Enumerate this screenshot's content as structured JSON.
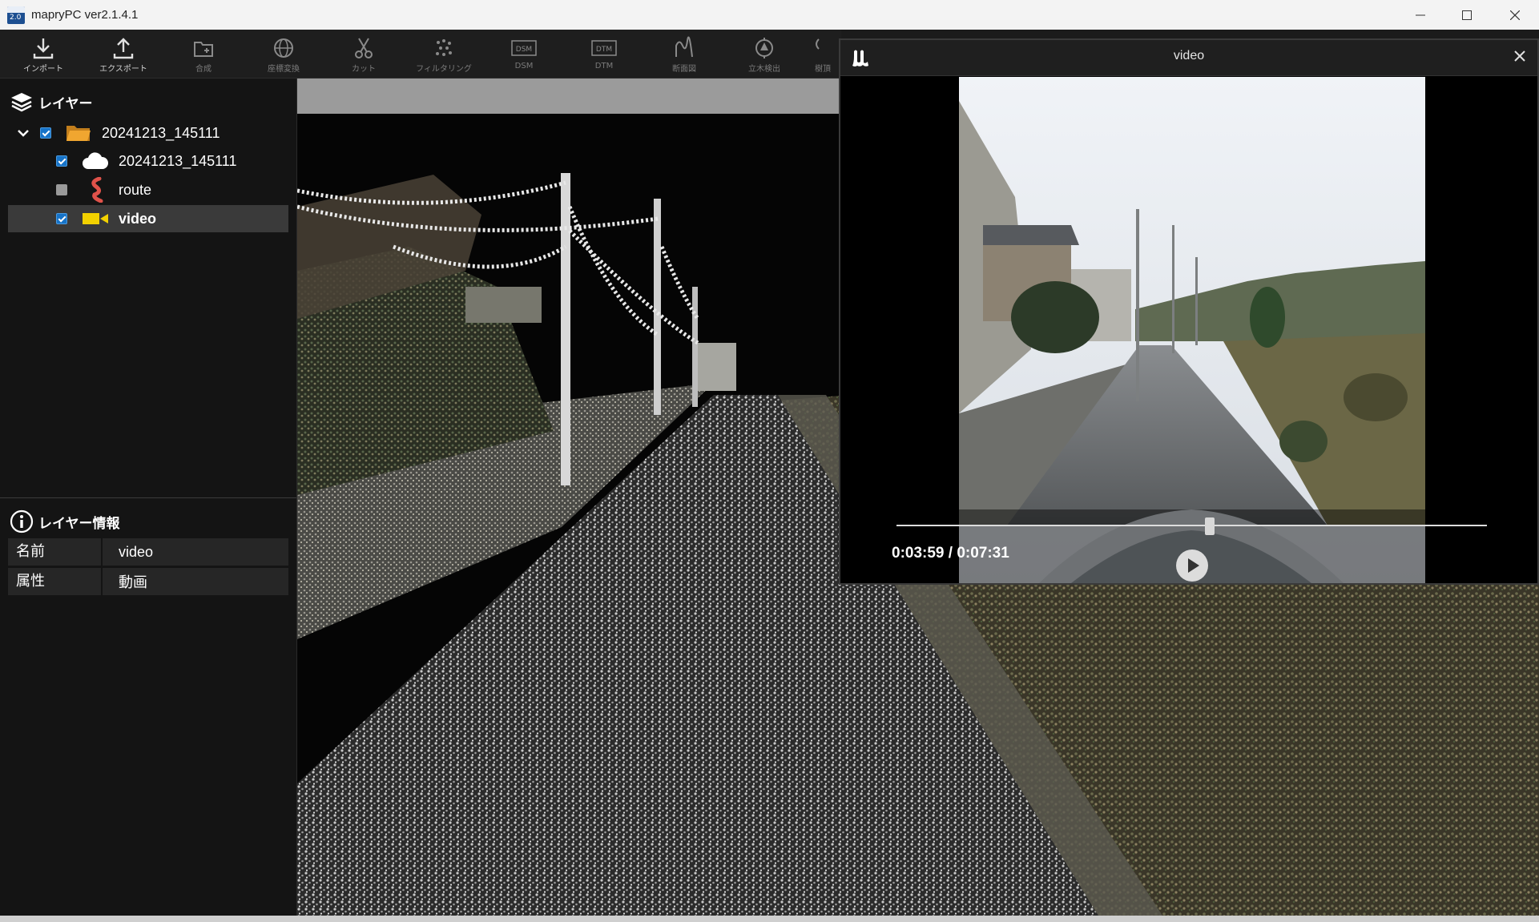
{
  "window": {
    "title": "mapryPC ver2.1.4.1"
  },
  "toolbar": {
    "items": [
      {
        "label": "インポート",
        "icon": "import-icon",
        "enabled": true
      },
      {
        "label": "エクスポート",
        "icon": "export-icon",
        "enabled": true
      },
      {
        "label": "合成",
        "icon": "merge-icon",
        "enabled": false
      },
      {
        "label": "座標変換",
        "icon": "globe-icon",
        "enabled": false
      },
      {
        "label": "カット",
        "icon": "scissors-icon",
        "enabled": false
      },
      {
        "label": "フィルタリング",
        "icon": "filter-icon",
        "enabled": false
      },
      {
        "label": "DSM",
        "icon": "dsm-icon",
        "enabled": false
      },
      {
        "label": "DTM",
        "icon": "dtm-icon",
        "enabled": false
      },
      {
        "label": "断面図",
        "icon": "cross-section-icon",
        "enabled": false
      },
      {
        "label": "立木検出",
        "icon": "tree-detect-icon",
        "enabled": false
      },
      {
        "label": "樹頂",
        "icon": "tree-top-icon",
        "enabled": false
      }
    ]
  },
  "layers": {
    "header": "レイヤー",
    "tree": [
      {
        "label": "20241213_145111",
        "type": "folder",
        "checked": true
      },
      {
        "label": "20241213_145111",
        "type": "pointcloud",
        "checked": true
      },
      {
        "label": "route",
        "type": "route",
        "checked": false
      },
      {
        "label": "video",
        "type": "video",
        "checked": true,
        "selected": true
      }
    ]
  },
  "layer_info": {
    "header": "レイヤー情報",
    "rows": [
      {
        "key": "名前",
        "value": "video"
      },
      {
        "key": "属性",
        "value": "動画"
      }
    ]
  },
  "video_window": {
    "title": "video",
    "time_current": "0:03:59",
    "time_total": "0:07:31",
    "time_text": "0:03:59 / 0:07:31",
    "progress": 0.53
  },
  "colors": {
    "accent": "#1673c8",
    "video_icon": "#f2d100",
    "route_icon": "#e0524a",
    "folder_icon": "#f0a630"
  }
}
